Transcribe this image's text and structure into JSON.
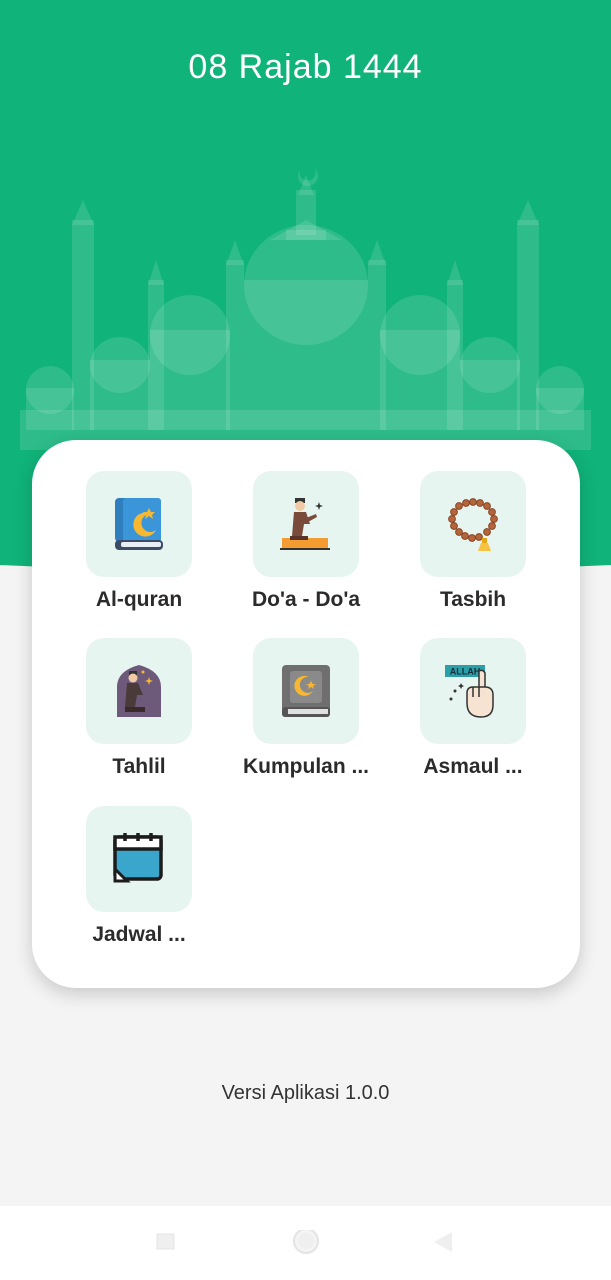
{
  "header": {
    "date": "08 Rajab 1444"
  },
  "colors": {
    "primary": "#10b37a",
    "tile_bg": "#e6f5f0",
    "background": "#f4f4f4"
  },
  "menu": [
    {
      "label": "Al-quran",
      "icon": "quran-book-icon"
    },
    {
      "label": "Do'a - Do'a",
      "icon": "praying-man-icon"
    },
    {
      "label": "Tasbih",
      "icon": "prayer-beads-icon"
    },
    {
      "label": "Tahlil",
      "icon": "tahlil-prayer-icon"
    },
    {
      "label": "Kumpulan ...",
      "icon": "quran-collection-icon"
    },
    {
      "label": "Asmaul ...",
      "icon": "allah-hand-icon"
    },
    {
      "label": "Jadwal ...",
      "icon": "calendar-icon"
    }
  ],
  "footer": {
    "version": "Versi Aplikasi 1.0.0"
  },
  "navbar": {
    "buttons": [
      "recent-apps-icon",
      "home-icon",
      "back-icon"
    ]
  }
}
